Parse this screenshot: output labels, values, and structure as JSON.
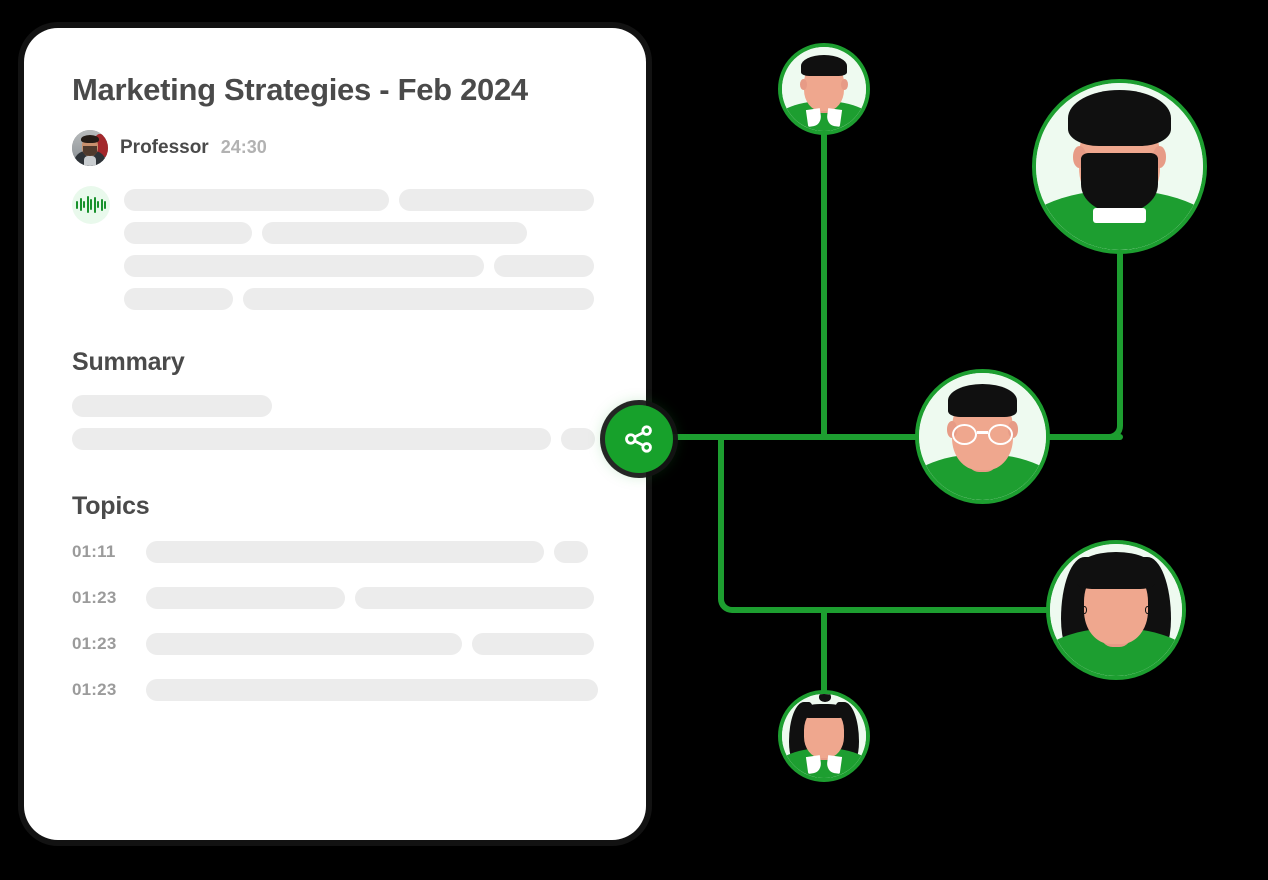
{
  "theme": {
    "brand_green": "#17a12b",
    "line_green": "#1d9e30",
    "skeleton_gray": "#ececec",
    "heading_gray": "#4a4a4a",
    "muted_gray": "#9b9b9b",
    "card_bg": "#ffffff",
    "page_bg": "#000000"
  },
  "card": {
    "title": "Marketing Strategies - Feb 2024",
    "speaker": {
      "name": "Professor",
      "duration": "24:30",
      "avatar_icon": "user-photo-avatar"
    },
    "transcript": {
      "icon": "audio-waveform-icon",
      "rows": [
        [
          56,
          41
        ],
        [
          27,
          56
        ],
        [
          76,
          21
        ],
        [
          23,
          74
        ]
      ]
    },
    "summary": {
      "heading": "Summary",
      "rows": [
        {
          "bars": [
            38
          ],
          "trailing_dot": false
        },
        {
          "bars": [
            91
          ],
          "trailing_dot": true
        }
      ]
    },
    "topics": {
      "heading": "Topics",
      "items": [
        {
          "time": "01:11",
          "bars": [
            88
          ],
          "trailing_dot": true
        },
        {
          "time": "01:23",
          "bars": [
            44,
            53
          ]
        },
        {
          "time": "01:23",
          "bars": [
            70,
            27
          ]
        },
        {
          "time": "01:23",
          "bars": [
            100
          ]
        }
      ]
    }
  },
  "share_button": {
    "icon": "share-nodes-icon",
    "label": "Share"
  },
  "network": {
    "nodes": [
      {
        "id": "member-top",
        "icon": "avatar-short-hair-collar",
        "size": 92
      },
      {
        "id": "member-bearded",
        "icon": "avatar-bearded-man",
        "size": 175
      },
      {
        "id": "member-glasses",
        "icon": "avatar-man-with-glasses",
        "size": 135
      },
      {
        "id": "member-long-hair",
        "icon": "avatar-woman-long-hair",
        "size": 140
      },
      {
        "id": "member-bottom",
        "icon": "avatar-woman-bun-collar",
        "size": 92
      }
    ]
  }
}
